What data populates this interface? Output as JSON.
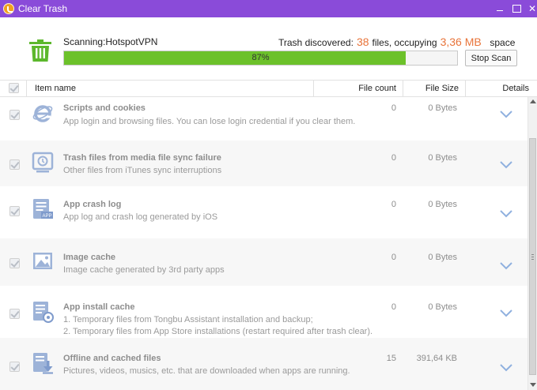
{
  "window": {
    "title": "Clear Trash",
    "minimize_glyph": "",
    "maximize_glyph": "",
    "close_glyph": "✕"
  },
  "scan": {
    "label": "Scanning:HotspotVPN",
    "discovered_label": "Trash discovered:",
    "discovered_count": "38",
    "files_label": "files, occupying",
    "occupied_size": "3,36 MB",
    "space_label": "space",
    "progress_percent": 87,
    "progress_text": "87%",
    "stop_button": "Stop Scan"
  },
  "table": {
    "headers": {
      "name": "Item name",
      "count": "File count",
      "size": "File Size",
      "details": "Details"
    },
    "rows": [
      {
        "icon": "internet-explorer-icon",
        "title": "Scripts and cookies",
        "desc": [
          "App login and browsing files. You can lose login credential if you clear them."
        ],
        "count": "0",
        "size": "0 Bytes"
      },
      {
        "icon": "itunes-sync-icon",
        "title": "Trash files from media file sync failure",
        "desc": [
          "Other files from iTunes sync interruptions"
        ],
        "count": "0",
        "size": "0 Bytes"
      },
      {
        "icon": "crash-log-icon",
        "title": "App crash log",
        "desc": [
          "App log and crash log generated by iOS"
        ],
        "count": "0",
        "size": "0 Bytes"
      },
      {
        "icon": "image-icon",
        "title": "Image cache",
        "desc": [
          "Image cache generated by 3rd party apps"
        ],
        "count": "0",
        "size": "0 Bytes"
      },
      {
        "icon": "install-cache-icon",
        "title": "App install cache",
        "desc": [
          "1. Temporary files from Tongbu Assistant installation and backup;",
          "2. Temporary files from App Store installations (restart required after trash clear)."
        ],
        "count": "0",
        "size": "0 Bytes"
      },
      {
        "icon": "download-cache-icon",
        "title": "Offline and cached files",
        "desc": [
          "Pictures, videos, musics, etc. that are downloaded when apps are running."
        ],
        "count": "15",
        "size": "391,64 KB"
      }
    ]
  },
  "colors": {
    "titlebar": "#8a4bd9",
    "accent_orange": "#e8743a",
    "progress_green": "#6cc12a",
    "trash_green": "#5cb82c",
    "icon_blue": "#9db3d8",
    "chevron_blue": "#8fb0df"
  }
}
